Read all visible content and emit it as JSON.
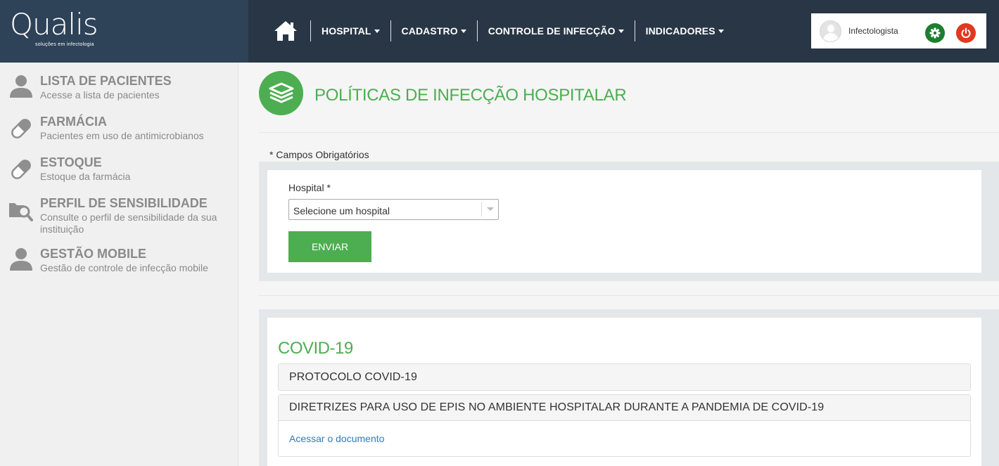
{
  "brand": {
    "logo_text": "Qualis",
    "tagline": "soluções em infectologia"
  },
  "nav": {
    "items": [
      {
        "label": "HOSPITAL"
      },
      {
        "label": "CADASTRO"
      },
      {
        "label": "CONTROLE DE INFECÇÃO"
      },
      {
        "label": "INDICADORES"
      }
    ]
  },
  "user": {
    "name": "Infectologista",
    "colors": {
      "settings": "#1e7d2f",
      "logout": "#e2381f"
    }
  },
  "sidebar": {
    "items": [
      {
        "title": "LISTA DE PACIENTES",
        "subtitle": "Acesse a lista de pacientes",
        "icon": "user-icon"
      },
      {
        "title": "FARMÁCIA",
        "subtitle": "Pacientes em uso de antimicrobianos",
        "icon": "pill-icon"
      },
      {
        "title": "ESTOQUE",
        "subtitle": "Estoque da farmácia",
        "icon": "pill-icon"
      },
      {
        "title": "PERFIL DE SENSIBILIDADE",
        "subtitle": "Consulte o perfil de sensibilidade da sua instituição",
        "icon": "folder-search-icon"
      },
      {
        "title": "GESTÃO MOBILE",
        "subtitle": "Gestão de controle de infecção mobile",
        "icon": "user-icon"
      }
    ]
  },
  "page": {
    "title": "POLÍTICAS DE INFECÇÃO HOSPITALAR",
    "accent_color": "#4cae50"
  },
  "form": {
    "required_note": "* Campos Obrigatórios",
    "hospital_label": "Hospital *",
    "hospital_select_value": "Selecione um hospital",
    "submit_label": "ENVIAR"
  },
  "covid": {
    "title": "COVID-19",
    "panels": [
      {
        "heading": "PROTOCOLO COVID-19"
      },
      {
        "heading": "DIRETRIZES PARA USO DE EPIS NO AMBIENTE HOSPITALAR DURANTE A PANDEMIA DE COVID-19",
        "link_text": "Acessar o documento"
      }
    ]
  }
}
